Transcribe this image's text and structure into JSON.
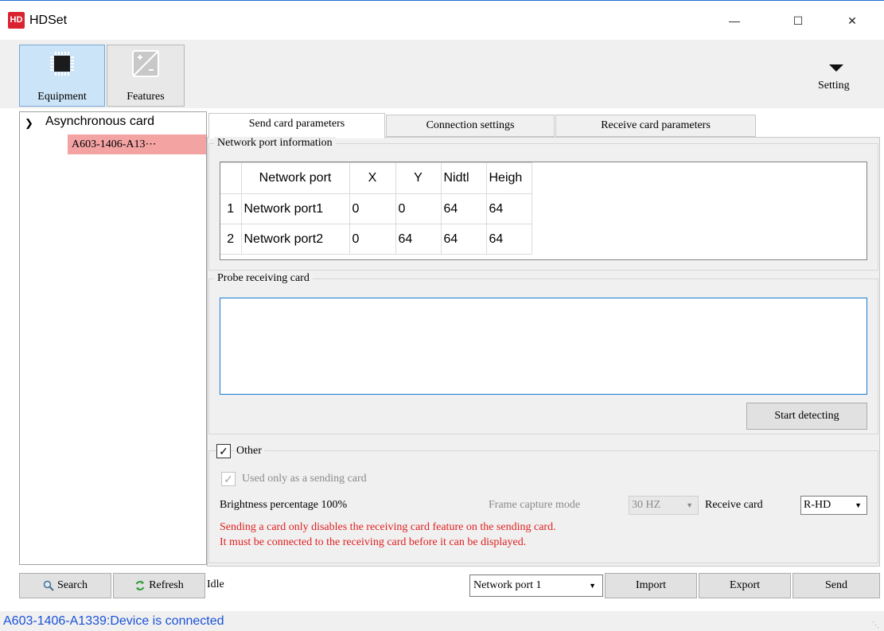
{
  "window": {
    "title": "HDSet",
    "logo_text": "HD",
    "minimize_glyph": "—",
    "maximize_glyph": "☐",
    "close_glyph": "✕"
  },
  "toolbar": {
    "equipment_label": "Equipment",
    "features_label": "Features",
    "setting_label": "Setting"
  },
  "tree": {
    "root_label": "Asynchronous card",
    "child_label": "A603-1406-A13⋯"
  },
  "tabs": {
    "send": "Send card parameters",
    "connection": "Connection settings",
    "receive": "Receive card parameters"
  },
  "network_group": {
    "title": "Network port information",
    "columns": [
      "Network port",
      "X",
      "Y",
      "Nidtl",
      "Heigh"
    ],
    "rows": [
      {
        "index": "1",
        "port": "Network port1",
        "x": "0",
        "y": "0",
        "width": "64",
        "height": "64"
      },
      {
        "index": "2",
        "port": "Network port2",
        "x": "0",
        "y": "64",
        "width": "64",
        "height": "64"
      }
    ]
  },
  "probe_group": {
    "title": "Probe receiving card",
    "detect_button": "Start detecting"
  },
  "other_group": {
    "title": "Other",
    "checked": true,
    "send_only_label": "Used only as a sending card",
    "brightness_label": "Brightness percentage 100%",
    "frame_capture_label": "Frame capture mode",
    "frame_capture_value": "30 HZ",
    "receive_card_label": "Receive card",
    "receive_card_value": "R-HD",
    "warning_line1": "Sending a card only disables the receiving card feature on the sending card.",
    "warning_line2": "It must be connected to the receiving card before it can be displayed."
  },
  "bottom": {
    "search_label": "Search",
    "refresh_label": "Refresh",
    "status": "Idle",
    "port_value": "Network port 1",
    "import_label": "Import",
    "export_label": "Export",
    "send_label": "Send"
  },
  "statusbar": {
    "message": "A603-1406-A1339:Device is connected"
  },
  "colors": {
    "selected_tree_bg": "#f4a3a3",
    "warning_text": "#e02020",
    "status_text": "#1a52d6",
    "logo_bg": "#d9232e"
  },
  "icons": {
    "logo": "hd-logo-icon",
    "equipment": "chip-icon",
    "features": "plus-minus-icon",
    "setting": "caret-down-icon",
    "search": "magnifier-icon",
    "refresh": "refresh-icon"
  }
}
